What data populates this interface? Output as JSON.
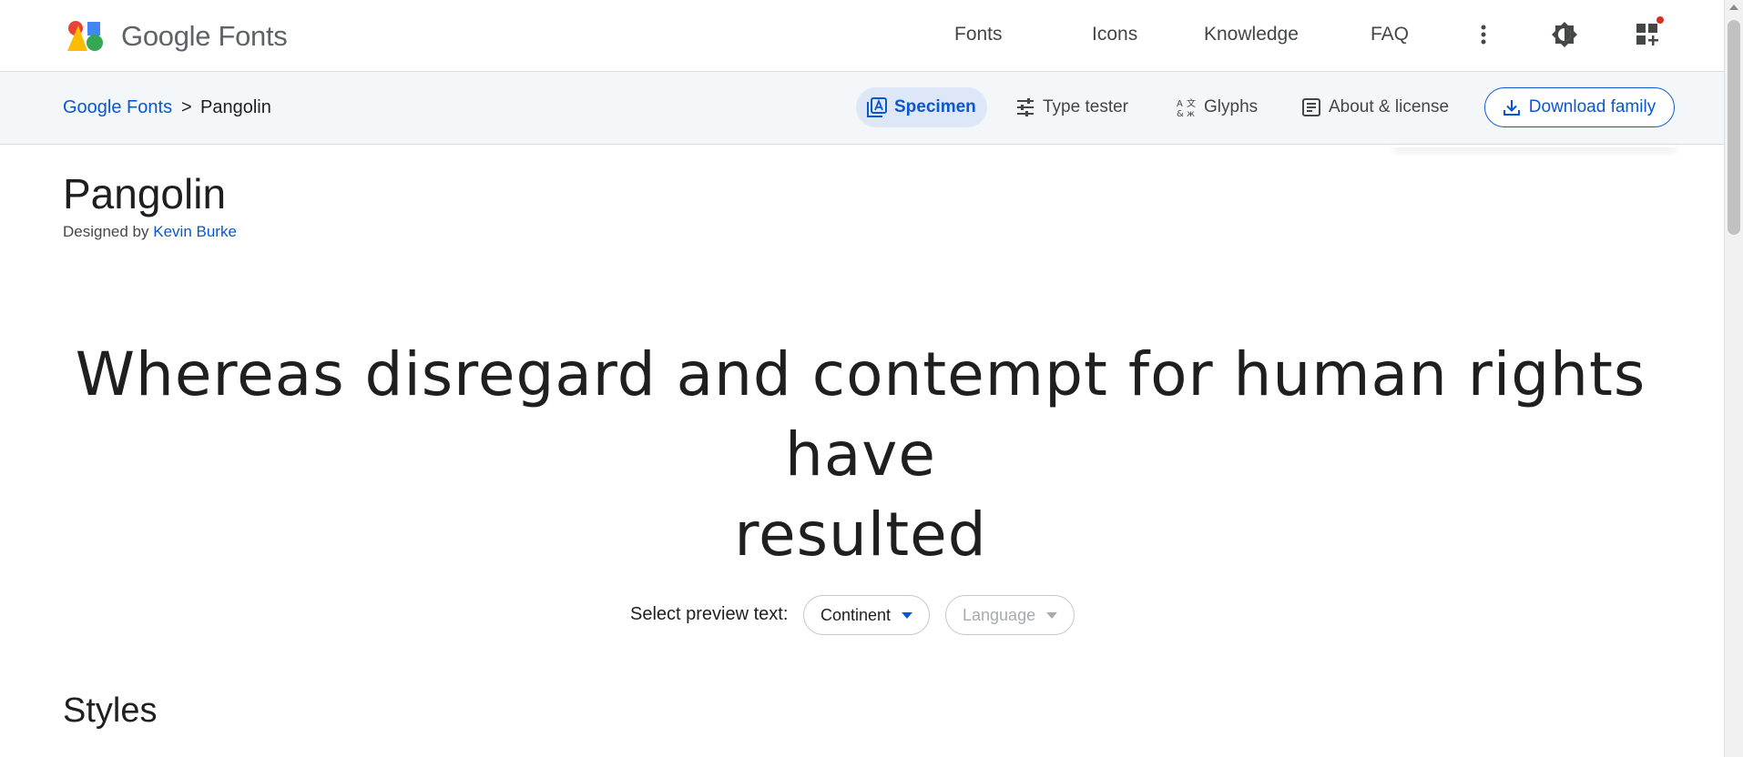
{
  "header": {
    "brand": "Google Fonts",
    "nav": [
      "Fonts",
      "Icons",
      "Knowledge",
      "FAQ"
    ],
    "icons": [
      "more-vert-icon",
      "theme-toggle-icon",
      "apps-add-icon"
    ]
  },
  "subbar": {
    "breadcrumb": {
      "root": "Google Fonts",
      "separator": ">",
      "current": "Pangolin"
    },
    "tabs": [
      {
        "label": "Specimen",
        "icon": "specimen-icon",
        "active": true
      },
      {
        "label": "Type tester",
        "icon": "tune-icon",
        "active": false
      },
      {
        "label": "Glyphs",
        "icon": "glyphs-icon",
        "active": false
      },
      {
        "label": "About & license",
        "icon": "article-icon",
        "active": false
      }
    ],
    "download_label": "Download family"
  },
  "font": {
    "name": "Pangolin",
    "designed_by_prefix": "Designed by",
    "designer": "Kevin Burke"
  },
  "preview": {
    "line1": "Whereas disregard and contempt for human rights have",
    "line2": "resulted"
  },
  "preview_select": {
    "label": "Select preview text:",
    "continent": "Continent",
    "language": "Language"
  },
  "styles_heading": "Styles",
  "colors": {
    "accent": "#0b57d0",
    "subbar_bg": "#f4f7fa",
    "active_tab_bg": "#dde7f8",
    "notification": "#d93025"
  }
}
